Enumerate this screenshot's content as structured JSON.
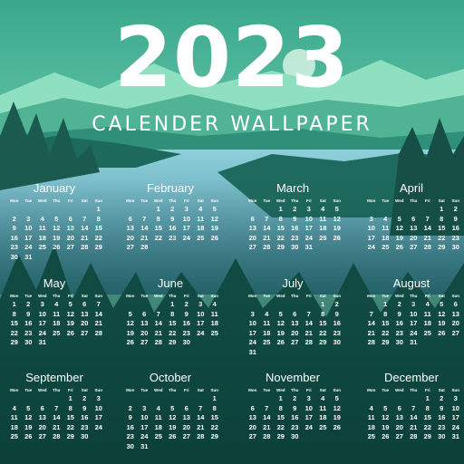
{
  "title": "2023",
  "subtitle": "CALENDER WALLPAPER",
  "weekdays": [
    "Mon",
    "Tue",
    "Wed",
    "Thu",
    "Fri",
    "Sat",
    "Sun"
  ],
  "months": [
    {
      "name": "January",
      "start": 6,
      "days": 31
    },
    {
      "name": "February",
      "start": 2,
      "days": 28
    },
    {
      "name": "March",
      "start": 2,
      "days": 31
    },
    {
      "name": "April",
      "start": 5,
      "days": 30
    },
    {
      "name": "May",
      "start": 0,
      "days": 31
    },
    {
      "name": "June",
      "start": 3,
      "days": 30
    },
    {
      "name": "July",
      "start": 5,
      "days": 31
    },
    {
      "name": "August",
      "start": 1,
      "days": 31
    },
    {
      "name": "September",
      "start": 4,
      "days": 30
    },
    {
      "name": "October",
      "start": 6,
      "days": 31
    },
    {
      "name": "November",
      "start": 2,
      "days": 30
    },
    {
      "name": "December",
      "start": 4,
      "days": 31
    }
  ],
  "colors": {
    "sky_top": "#5fc7a5",
    "mountain": "#7fd9b8",
    "water": "#6fa9bc",
    "forest": "#0f4a42",
    "text": "#ffffff"
  }
}
